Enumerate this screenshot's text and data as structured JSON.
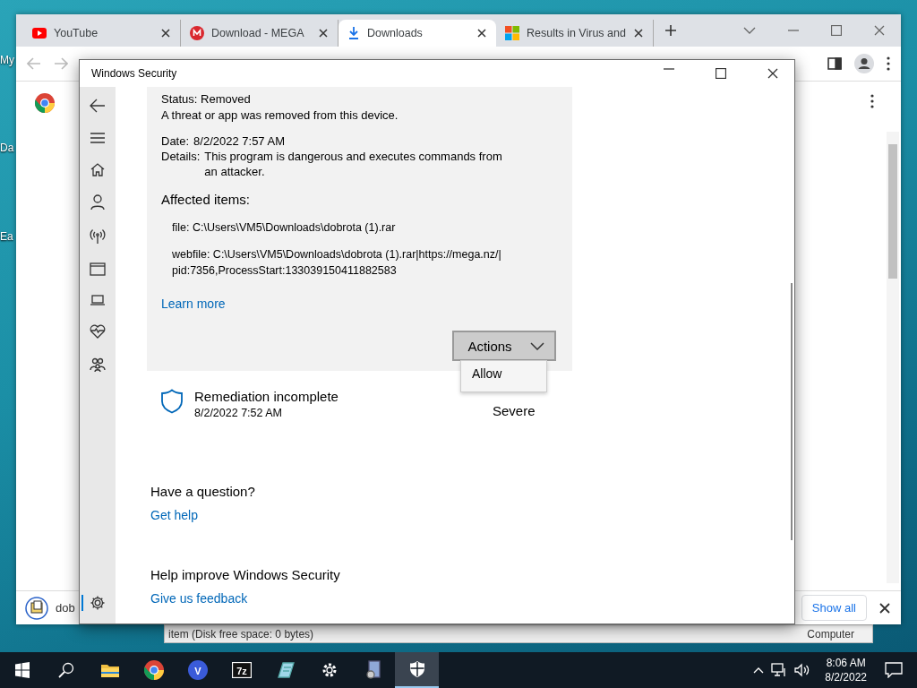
{
  "desktop_icons": [
    {
      "label": "My"
    },
    {
      "label": "Da"
    },
    {
      "label": "Ea"
    }
  ],
  "background_window": {
    "status": "item (Disk free space: 0 bytes)",
    "location": "Computer"
  },
  "browser": {
    "tabs": [
      {
        "kind": "youtube",
        "title": "YouTube",
        "selected": false
      },
      {
        "kind": "mega",
        "title": "Download - MEGA",
        "selected": false
      },
      {
        "kind": "download",
        "title": "Downloads",
        "selected": true
      },
      {
        "kind": "microsoft",
        "title": "Results in Virus and ",
        "selected": false
      }
    ],
    "download_bar": {
      "file": "dob",
      "show_all": "Show all"
    }
  },
  "security_window": {
    "title": "Windows Security",
    "nav": [
      {
        "kind": "back",
        "selected": false
      },
      {
        "kind": "menu",
        "selected": false
      },
      {
        "kind": "home",
        "selected": false
      },
      {
        "kind": "person",
        "selected": false
      },
      {
        "kind": "antenna",
        "selected": false
      },
      {
        "kind": "window",
        "selected": false
      },
      {
        "kind": "laptop",
        "selected": false
      },
      {
        "kind": "heart",
        "selected": false
      },
      {
        "kind": "family",
        "selected": false
      },
      {
        "kind": "settings",
        "selected": true
      }
    ],
    "threat": {
      "status_label": "Status:",
      "status": "Removed",
      "summary": "A threat or app was removed from this device.",
      "date_label": "Date:",
      "date": "8/2/2022 7:57 AM",
      "details_label": "Details:",
      "details": "This program is dangerous and executes commands from an attacker.",
      "affected_heading": "Affected items:",
      "affected": [
        {
          "lines": [
            "file: C:\\Users\\VM5\\Downloads\\dobrota (1).rar"
          ]
        },
        {
          "lines": [
            "webfile: C:\\Users\\VM5\\Downloads\\dobrota (1).rar|https://mega.nz/|",
            "pid:7356,ProcessStart:133039150411882583"
          ]
        }
      ],
      "learn_more": "Learn more",
      "actions": "Actions",
      "menu": [
        "Allow"
      ]
    },
    "remediation": {
      "title": "Remediation incomplete",
      "date": "8/2/2022 7:52 AM",
      "severity": "Severe"
    },
    "help": {
      "question": "Have a question?",
      "get_help": "Get help",
      "improve": "Help improve Windows Security",
      "feedback": "Give us feedback"
    }
  },
  "taskbar": {
    "apps": [
      {
        "kind": "start",
        "selected": false
      },
      {
        "kind": "search",
        "selected": false
      },
      {
        "kind": "folder",
        "selected": false
      },
      {
        "kind": "chrome",
        "selected": false
      },
      {
        "kind": "circle-letter",
        "label": "V",
        "selected": false
      },
      {
        "kind": "box-letter",
        "label": "7z",
        "selected": false
      },
      {
        "kind": "notepad",
        "selected": false
      },
      {
        "kind": "gear",
        "selected": false
      },
      {
        "kind": "media",
        "selected": false
      },
      {
        "kind": "shield",
        "selected": true
      }
    ],
    "time": "8:06 AM",
    "date": "8/2/2022"
  }
}
